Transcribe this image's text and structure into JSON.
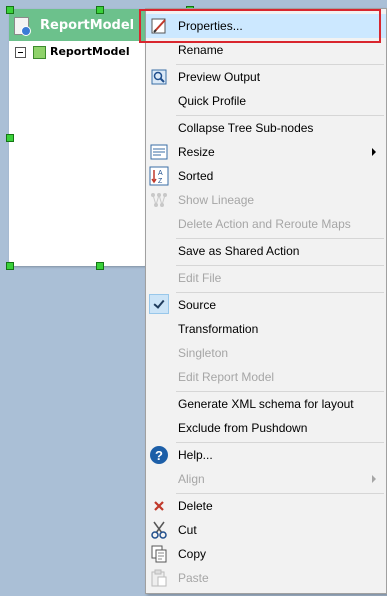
{
  "node": {
    "title": "ReportModel",
    "tree_item": "ReportModel"
  },
  "menu": {
    "items": [
      {
        "label": "Properties...",
        "icon": "properties-icon",
        "enabled": true,
        "highlighted": true
      },
      {
        "label": "Rename",
        "enabled": true
      },
      {
        "label": "Preview Output",
        "icon": "preview-icon",
        "enabled": true
      },
      {
        "label": "Quick Profile",
        "enabled": true
      },
      {
        "label": "Collapse Tree Sub-nodes",
        "enabled": true
      },
      {
        "label": "Resize",
        "icon": "resize-icon",
        "enabled": true,
        "submenu": true
      },
      {
        "label": "Sorted",
        "icon": "sort-az-icon",
        "enabled": true
      },
      {
        "label": "Show Lineage",
        "icon": "lineage-icon",
        "enabled": false
      },
      {
        "label": "Delete Action and Reroute Maps",
        "enabled": false
      },
      {
        "label": "Save as Shared Action",
        "enabled": true
      },
      {
        "label": "Edit File",
        "enabled": false
      },
      {
        "label": "Source",
        "enabled": true,
        "checked": true
      },
      {
        "label": "Transformation",
        "enabled": true
      },
      {
        "label": "Singleton",
        "enabled": false
      },
      {
        "label": "Edit Report Model",
        "enabled": false
      },
      {
        "label": "Generate XML schema for layout",
        "enabled": true
      },
      {
        "label": "Exclude from Pushdown",
        "enabled": true
      },
      {
        "label": "Help...",
        "icon": "help-icon",
        "enabled": true
      },
      {
        "label": "Align",
        "enabled": false,
        "submenu": true
      },
      {
        "label": "Delete",
        "icon": "delete-icon",
        "enabled": true
      },
      {
        "label": "Cut",
        "icon": "cut-icon",
        "enabled": true
      },
      {
        "label": "Copy",
        "icon": "copy-icon",
        "enabled": true
      },
      {
        "label": "Paste",
        "icon": "paste-icon",
        "enabled": false
      }
    ]
  },
  "colors": {
    "canvas": "#aabfd6",
    "node_header": "#6cc18c",
    "highlight": "#cce8ff",
    "focus_outline": "#d9262e"
  }
}
